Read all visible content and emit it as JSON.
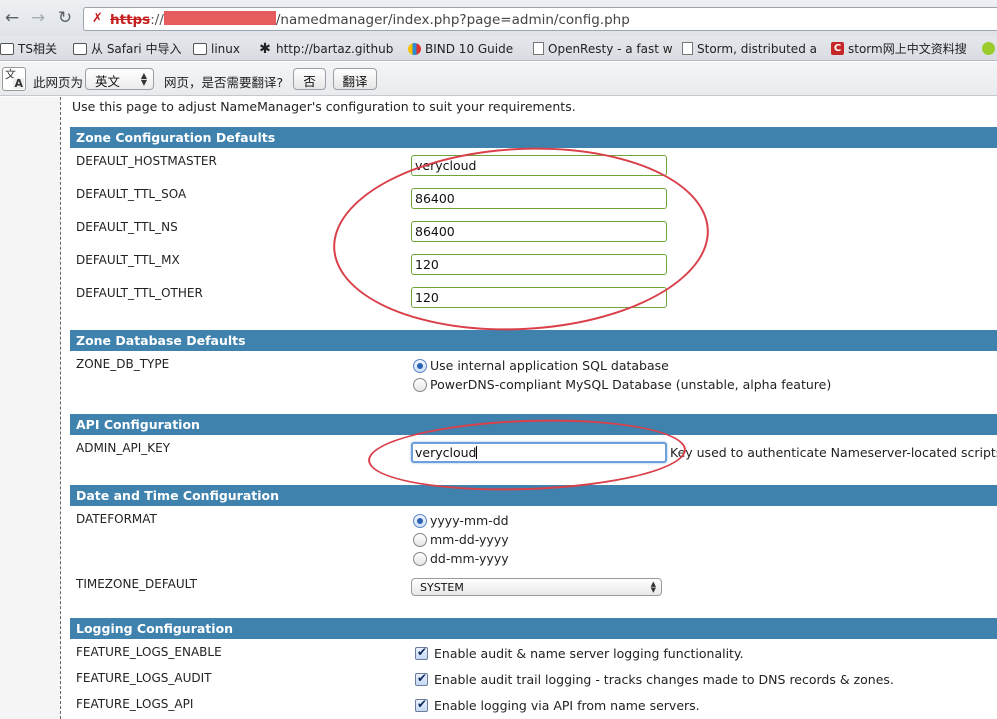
{
  "browser": {
    "back_icon": "back-arrow-icon",
    "forward_icon": "forward-arrow-icon",
    "reload_icon": "reload-icon",
    "url_scheme": "https",
    "url_sep": "://",
    "url_path": "/namedmanager/index.php?page=admin/config.php"
  },
  "bookmarks": [
    {
      "label": "TS相关",
      "icon": "folder-icon"
    },
    {
      "label": "从 Safari 中导入",
      "icon": "folder-icon"
    },
    {
      "label": "linux",
      "icon": "folder-icon"
    },
    {
      "label": "http://bartaz.github",
      "icon": "asterisk-icon"
    },
    {
      "label": "BIND 10 Guide",
      "icon": "bind-logo-icon"
    },
    {
      "label": "OpenResty - a fast w",
      "icon": "page-icon"
    },
    {
      "label": "Storm, distributed a",
      "icon": "page-icon"
    },
    {
      "label": "storm网上中文资料搜",
      "icon": "c-logo-icon"
    }
  ],
  "translate": {
    "prefix": "此网页为",
    "language": "英文",
    "question": "网页，是否需要翻译?",
    "no_label": "否",
    "translate_label": "翻译"
  },
  "page": {
    "intro": "Use this page to adjust NameManager's configuration to suit your requirements.",
    "zone_config": {
      "title": "Zone Configuration Defaults",
      "rows": [
        {
          "label": "DEFAULT_HOSTMASTER",
          "value": "verycloud"
        },
        {
          "label": "DEFAULT_TTL_SOA",
          "value": "86400"
        },
        {
          "label": "DEFAULT_TTL_NS",
          "value": "86400"
        },
        {
          "label": "DEFAULT_TTL_MX",
          "value": "120"
        },
        {
          "label": "DEFAULT_TTL_OTHER",
          "value": "120"
        }
      ]
    },
    "zone_db": {
      "title": "Zone Database Defaults",
      "label": "ZONE_DB_TYPE",
      "options": [
        {
          "label": "Use internal application SQL database",
          "selected": true
        },
        {
          "label": "PowerDNS-compliant MySQL Database (unstable, alpha feature)",
          "selected": false
        }
      ]
    },
    "api": {
      "title": "API Configuration",
      "label": "ADMIN_API_KEY",
      "value": "verycloud",
      "hint": "Key used to authenticate Nameserver-located scripts."
    },
    "datetime": {
      "title": "Date and Time Configuration",
      "format_label": "DATEFORMAT",
      "formats": [
        {
          "label": "yyyy-mm-dd",
          "selected": true
        },
        {
          "label": "mm-dd-yyyy",
          "selected": false
        },
        {
          "label": "dd-mm-yyyy",
          "selected": false
        }
      ],
      "timezone_label": "TIMEZONE_DEFAULT",
      "timezone_value": "SYSTEM"
    },
    "logging": {
      "title": "Logging Configuration",
      "rows": [
        {
          "label": "FEATURE_LOGS_ENABLE",
          "text": "Enable audit & name server logging functionality.",
          "checked": true
        },
        {
          "label": "FEATURE_LOGS_AUDIT",
          "text": "Enable audit trail logging - tracks changes made to DNS records & zones.",
          "checked": true
        },
        {
          "label": "FEATURE_LOGS_API",
          "text": "Enable logging via API from name servers.",
          "checked": true
        }
      ]
    }
  },
  "colors": {
    "section_header": "#3e82ad",
    "annotation_red": "#d9404a",
    "input_border": "#6ea43a"
  }
}
